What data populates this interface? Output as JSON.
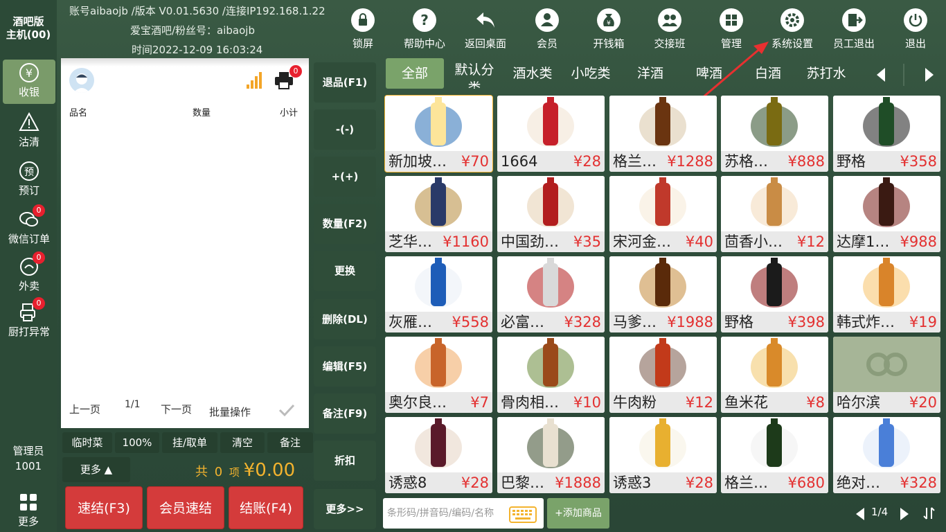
{
  "sidebar": {
    "host_line1": "酒吧版",
    "host_line2": "主机(00)",
    "items": [
      {
        "label": "收银",
        "icon": "yen-icon",
        "badge": null
      },
      {
        "label": "沽清",
        "icon": "warning-icon",
        "badge": null
      },
      {
        "label": "预订",
        "icon": "reserve-icon",
        "badge": null
      },
      {
        "label": "微信订单",
        "icon": "wechat-icon",
        "badge": "0"
      },
      {
        "label": "外卖",
        "icon": "takeout-icon",
        "badge": "0"
      },
      {
        "label": "厨打异常",
        "icon": "kitchen-print-icon",
        "badge": "0"
      }
    ],
    "admin_label": "管理员",
    "admin_id": "1001",
    "more_label": "更多"
  },
  "header": {
    "account_line": "账号aibaojb /版本 V0.01.5630 /连接IP192.168.1.22",
    "store_line": "爱宝酒吧/粉丝号：aibaojb",
    "time_line": "时间2022-12-09 16:03:24",
    "tools": [
      {
        "label": "锁屏",
        "icon": "lock-icon"
      },
      {
        "label": "帮助中心",
        "icon": "help-icon"
      },
      {
        "label": "返回桌面",
        "icon": "back-icon"
      },
      {
        "label": "会员",
        "icon": "member-icon"
      },
      {
        "label": "开钱箱",
        "icon": "money-bag-icon"
      },
      {
        "label": "交接班",
        "icon": "shift-icon"
      },
      {
        "label": "管理",
        "icon": "manage-icon"
      },
      {
        "label": "系统设置",
        "icon": "gear-icon"
      },
      {
        "label": "员工退出",
        "icon": "staff-exit-icon"
      },
      {
        "label": "退出",
        "icon": "power-icon"
      }
    ]
  },
  "order": {
    "printer_badge": "0",
    "col_name": "品名",
    "col_qty": "数量",
    "col_subtotal": "小计",
    "prev_page": "上一页",
    "page_indicator": "1/1",
    "next_page": "下一页",
    "batch": "批量操作"
  },
  "quick": {
    "temp_dish": "临时菜",
    "percent": "100%",
    "hang": "挂/取单",
    "clear": "清空",
    "note": "备注",
    "more": "更多"
  },
  "summary": {
    "prefix": "共",
    "count": "0",
    "unit": "项",
    "total": "¥0.00"
  },
  "actions": {
    "quick_checkout": "速结(F3)",
    "member_quick": "会员速结",
    "checkout": "结账(F4)"
  },
  "functions": [
    "退品(F1)",
    "-(-)",
    "+(+)",
    "数量(F2)",
    "更换",
    "删除(DL)",
    "编辑(F5)",
    "备注(F9)",
    "折扣",
    "更多>>"
  ],
  "categories": [
    "全部",
    "默认分类",
    "酒水类",
    "小吃类",
    "洋酒",
    "啤酒",
    "白酒",
    "苏打水"
  ],
  "products": [
    {
      "name": "新加坡…",
      "price": "¥70"
    },
    {
      "name": "1664",
      "price": "¥28"
    },
    {
      "name": "格兰…",
      "price": "¥1288"
    },
    {
      "name": "苏格…",
      "price": "¥888"
    },
    {
      "name": "野格",
      "price": "¥358"
    },
    {
      "name": "芝华…",
      "price": "¥1160"
    },
    {
      "name": "中国劲…",
      "price": "¥35"
    },
    {
      "name": "宋河金…",
      "price": "¥40"
    },
    {
      "name": "茴香小…",
      "price": "¥12"
    },
    {
      "name": "达摩1…",
      "price": "¥988"
    },
    {
      "name": "灰雁…",
      "price": "¥558"
    },
    {
      "name": "必富…",
      "price": "¥328"
    },
    {
      "name": "马爹…",
      "price": "¥1988"
    },
    {
      "name": "野格",
      "price": "¥398"
    },
    {
      "name": "韩式炸…",
      "price": "¥19"
    },
    {
      "name": "奥尔良…",
      "price": "¥7"
    },
    {
      "name": "骨肉相…",
      "price": "¥10"
    },
    {
      "name": "牛肉粉",
      "price": "¥12"
    },
    {
      "name": "鱼米花",
      "price": "¥8"
    },
    {
      "name": "哈尔滨",
      "price": "¥20"
    },
    {
      "name": "诱惑8",
      "price": "¥28"
    },
    {
      "name": "巴黎…",
      "price": "¥1888"
    },
    {
      "name": "诱惑3",
      "price": "¥28"
    },
    {
      "name": "格兰…",
      "price": "¥680"
    },
    {
      "name": "绝对…",
      "price": "¥328"
    }
  ],
  "search": {
    "placeholder": "条形码/拼音码/编码/名称"
  },
  "add_product": "+添加商品",
  "grid_pager": "1/4",
  "colors": {
    "accent_green": "#7aa36a",
    "price_red": "#e33030",
    "summary_gold": "#f3b32e",
    "button_red": "#d43b3b"
  }
}
